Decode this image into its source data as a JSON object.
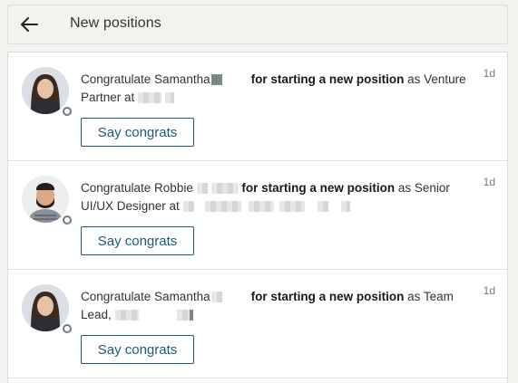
{
  "header": {
    "back_icon": "arrow-left-icon",
    "title": "New positions"
  },
  "cards": [
    {
      "prefix": "Congratulate Samantha",
      "bold": "for starting a new position",
      "suffix1": " as Venture",
      "line2": "Partner at",
      "time": "1d",
      "button": "Say congrats"
    },
    {
      "prefix": "Congratulate Robbie",
      "bold": "for starting a new position",
      "suffix1": " as Senior",
      "line2": "UI/UX Designer at",
      "time": "1d",
      "button": "Say congrats"
    },
    {
      "prefix": "Congratulate Samantha",
      "bold": "for starting a new position",
      "suffix1": " as Team",
      "line2": "Lead,",
      "time": "1d",
      "button": "Say congrats"
    }
  ],
  "colors": {
    "accent": "#1e5a7a",
    "presence_ring": "#6b7b84"
  }
}
